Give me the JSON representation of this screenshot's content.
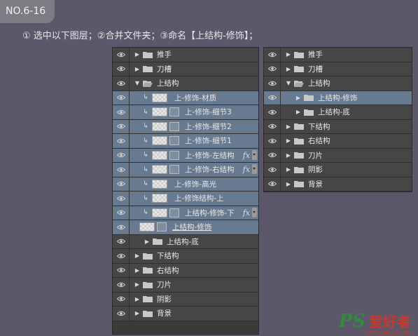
{
  "badge": "NO.6-16",
  "instruction": "① 选中以下图层；②合并文件夹；③命名【上结构-修饰】；",
  "left_layers": [
    {
      "label": "推手",
      "type": "folder",
      "collapsed": true,
      "indent": 0,
      "selected": false
    },
    {
      "label": "刀槽",
      "type": "folder",
      "collapsed": true,
      "indent": 0,
      "selected": false
    },
    {
      "label": "上结构",
      "type": "folder",
      "collapsed": false,
      "indent": 0,
      "selected": false
    },
    {
      "label": "上-修饰-材质",
      "type": "layer",
      "clip": true,
      "mask": false,
      "fx": false,
      "selected": true
    },
    {
      "label": "上-修饰-细节3",
      "type": "layer",
      "clip": true,
      "mask": true,
      "fx": false,
      "selected": true
    },
    {
      "label": "上-修饰-细节2",
      "type": "layer",
      "clip": true,
      "mask": true,
      "fx": false,
      "selected": true
    },
    {
      "label": "上-修饰-细节1",
      "type": "layer",
      "clip": true,
      "mask": true,
      "fx": false,
      "selected": true
    },
    {
      "label": "上-修饰-左结构",
      "type": "layer",
      "clip": true,
      "mask": true,
      "fx": true,
      "selected": true
    },
    {
      "label": "上-修饰-右结构",
      "type": "layer",
      "clip": true,
      "mask": true,
      "fx": true,
      "selected": true
    },
    {
      "label": "上-修饰-高光",
      "type": "layer",
      "clip": true,
      "mask": false,
      "fx": false,
      "selected": true
    },
    {
      "label": "上-修饰结构-上",
      "type": "layer",
      "clip": true,
      "mask": false,
      "fx": false,
      "selected": true
    },
    {
      "label": "上结构-修饰-下",
      "type": "layer",
      "clip": true,
      "mask": true,
      "fx": true,
      "selected": true
    },
    {
      "label": "上结构-修饰",
      "type": "layer",
      "clip": false,
      "mask": true,
      "fx": false,
      "selected": true,
      "underline": true
    },
    {
      "label": "上结构-底",
      "type": "folder",
      "collapsed": true,
      "indent": 1,
      "selected": false
    },
    {
      "label": "下结构",
      "type": "folder",
      "collapsed": true,
      "indent": 0,
      "selected": false
    },
    {
      "label": "右结构",
      "type": "folder",
      "collapsed": true,
      "indent": 0,
      "selected": false
    },
    {
      "label": "刀片",
      "type": "folder",
      "collapsed": true,
      "indent": 0,
      "selected": false
    },
    {
      "label": "阴影",
      "type": "folder",
      "collapsed": true,
      "indent": 0,
      "selected": false
    },
    {
      "label": "背景",
      "type": "folder",
      "collapsed": true,
      "indent": 0,
      "selected": false
    }
  ],
  "right_layers": [
    {
      "label": "推手",
      "collapsed": true,
      "indent": 0,
      "selected": false
    },
    {
      "label": "刀槽",
      "collapsed": true,
      "indent": 0,
      "selected": false
    },
    {
      "label": "上结构",
      "collapsed": false,
      "indent": 0,
      "selected": false
    },
    {
      "label": "上结构-修饰",
      "collapsed": true,
      "indent": 1,
      "selected": true
    },
    {
      "label": "上结构-底",
      "collapsed": true,
      "indent": 1,
      "selected": false
    },
    {
      "label": "下结构",
      "collapsed": true,
      "indent": 0,
      "selected": false
    },
    {
      "label": "右结构",
      "collapsed": true,
      "indent": 0,
      "selected": false
    },
    {
      "label": "刀片",
      "collapsed": true,
      "indent": 0,
      "selected": false
    },
    {
      "label": "阴影",
      "collapsed": true,
      "indent": 0,
      "selected": false
    },
    {
      "label": "背景",
      "collapsed": true,
      "indent": 0,
      "selected": false
    }
  ],
  "watermark": {
    "brand": "PS",
    "cn": "爱好者",
    "url": "www.psahz.com"
  },
  "colors": {
    "background": "#5d5869",
    "row": "#464646",
    "selected": "#687a8f",
    "panel": "#3a3a3a"
  }
}
